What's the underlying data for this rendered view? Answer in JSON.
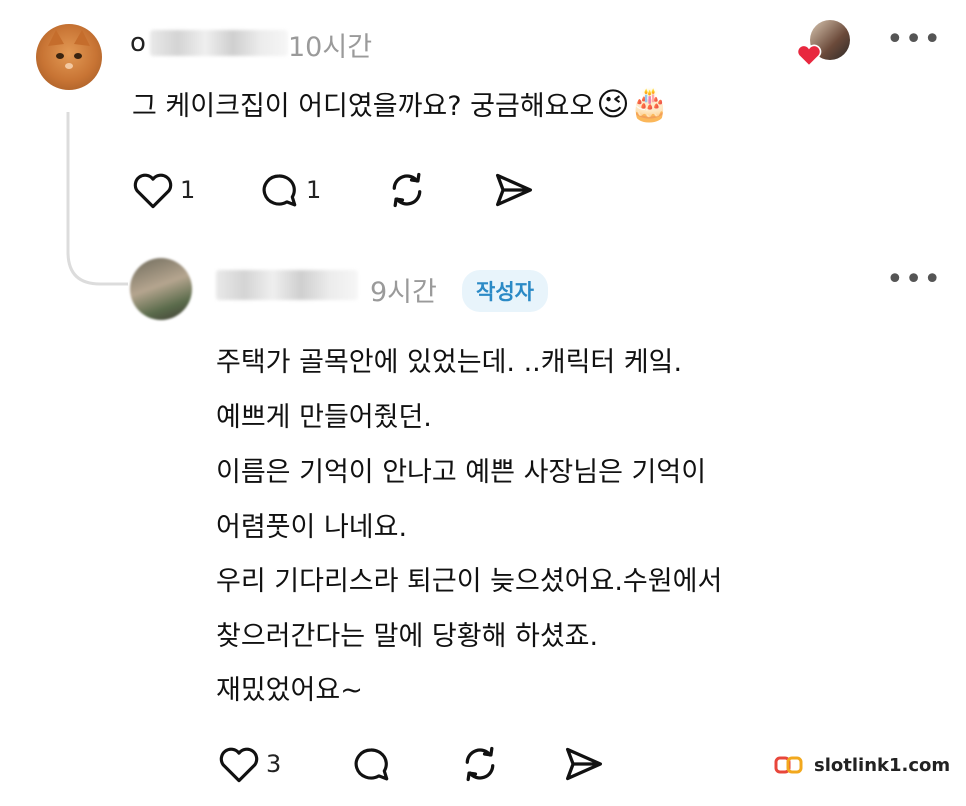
{
  "comment": {
    "username_visible": "o",
    "time": "10시간",
    "text": "그 케이크집이 어디였을까요? 궁금해요오",
    "emoji_wink": "😉",
    "emoji_cake": "🎂",
    "like_count": "1",
    "reply_count": "1"
  },
  "reply": {
    "time": "9시간",
    "author_badge": "작성자",
    "lines": [
      "주택가 골목안에 있었는데. ..캐릭터 케잌.",
      "예쁘게 만들어줬던.",
      "이름은 기억이 안나고 예쁜 사장님은 기억이",
      "어렴풋이 나네요.",
      "우리 기다리스라 퇴근이 늦으셨어요.수원에서",
      "찾으러간다는 말에 당황해 하셨죠.",
      "재밌었어요~"
    ],
    "like_count": "3"
  },
  "more_label": "•••",
  "watermark": {
    "text": "slotlink1.com"
  }
}
